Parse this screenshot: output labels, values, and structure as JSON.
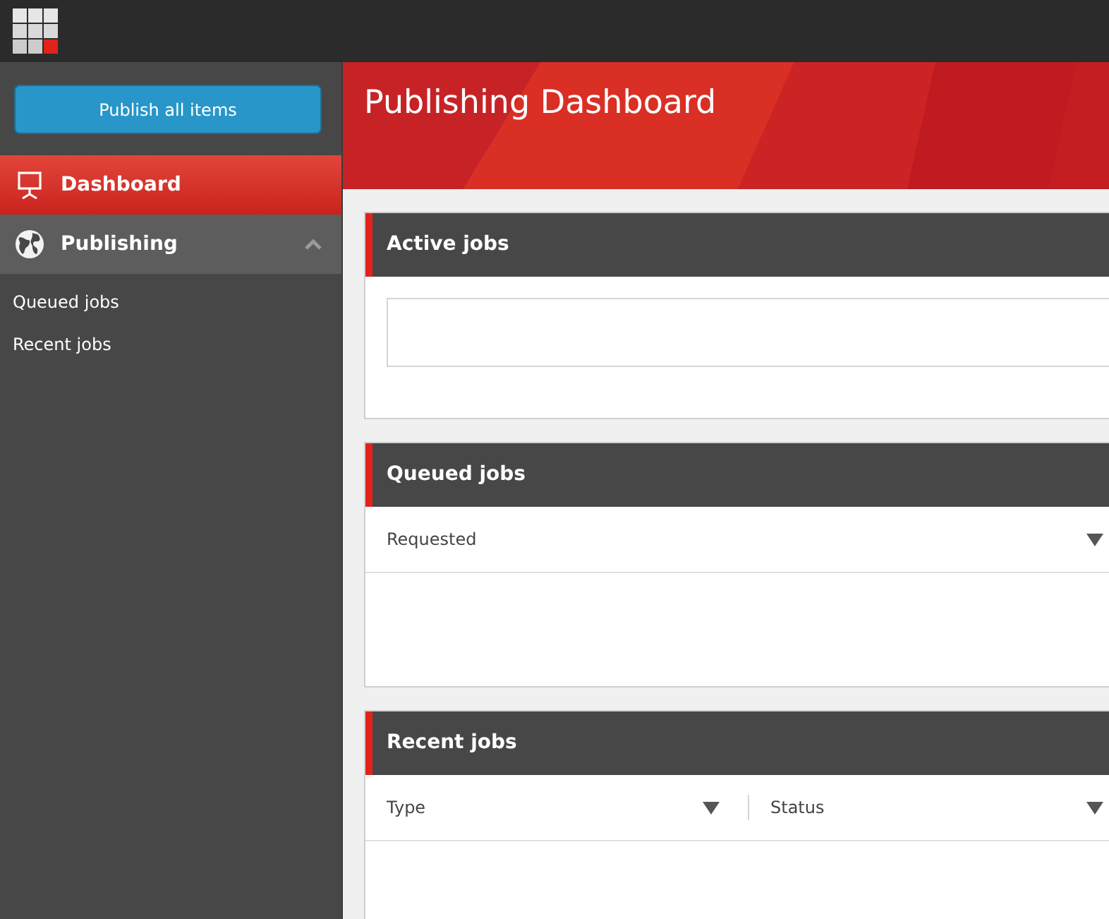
{
  "sidebar": {
    "publish_button": "Publish all items",
    "nav": [
      {
        "label": "Dashboard",
        "selected": true
      },
      {
        "label": "Publishing",
        "selected": false,
        "expanded": true,
        "children": [
          {
            "label": "Queued jobs"
          },
          {
            "label": "Recent jobs"
          }
        ]
      }
    ]
  },
  "header": {
    "title": "Publishing Dashboard"
  },
  "panels": [
    {
      "title": "Active jobs",
      "kind": "empty"
    },
    {
      "title": "Queued jobs",
      "kind": "table",
      "columns": [
        {
          "label": "Requested"
        }
      ]
    },
    {
      "title": "Recent jobs",
      "kind": "table",
      "columns": [
        {
          "label": "Type"
        },
        {
          "label": "Status"
        }
      ]
    }
  ]
}
